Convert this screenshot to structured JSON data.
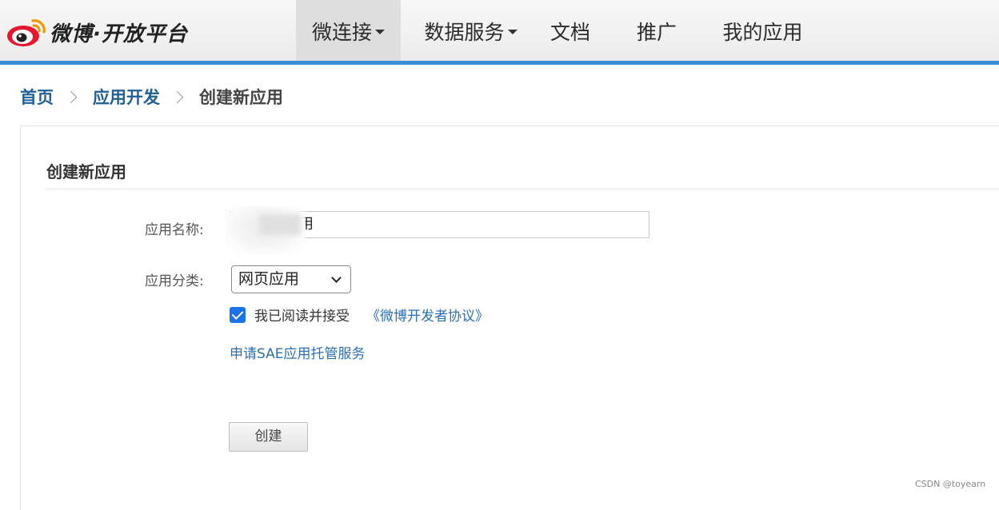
{
  "header": {
    "brand": "微博·开放平台",
    "nav": [
      {
        "label": "微连接",
        "dropdown": true,
        "active": true
      },
      {
        "label": "数据服务",
        "dropdown": true,
        "active": false
      },
      {
        "label": "文档",
        "dropdown": false,
        "active": false
      },
      {
        "label": "推广",
        "dropdown": false,
        "active": false
      },
      {
        "label": "我的应用",
        "dropdown": false,
        "active": false
      }
    ]
  },
  "breadcrumb": {
    "home": "首页",
    "section": "应用开发",
    "current": "创建新应用"
  },
  "form": {
    "title": "创建新应用",
    "app_name_label": "应用名称:",
    "app_name_value": "用",
    "category_label": "应用分类:",
    "category_value": "网页应用",
    "agree_checked": true,
    "agree_text": "我已阅读并接受",
    "agree_link": "《微博开发者协议》",
    "sae_link": "申请SAE应用托管服务",
    "create_button": "创建"
  },
  "watermark": "CSDN @toyearn",
  "colors": {
    "accent_bar": "#3a8fd6",
    "link": "#2a6fb5",
    "checkbox": "#1a73e8"
  }
}
